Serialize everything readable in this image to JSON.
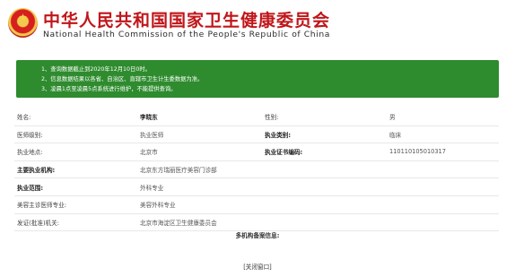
{
  "header": {
    "title_cn": "中华人民共和国国家卫生健康委员会",
    "title_en": "National Health Commission of the People's Republic of China",
    "emblem_icon": "national-emblem-icon"
  },
  "notice": {
    "lines": [
      "1、查询数据截止到2020年12月10日0时。",
      "2、信息数据结果以各省、自治区、直辖市卫生计生委数据为准。",
      "3、凌晨1点至凌晨5点系统进行维护，不能提供查询。"
    ],
    "background_color": "#2e8b2e"
  },
  "info": {
    "name_label": "姓名:",
    "name_value": "李晓东",
    "gender_label": "性别:",
    "gender_value": "男",
    "level_label": "医师级别:",
    "level_value": "执业医师",
    "category_label": "执业类别:",
    "category_value": "临床",
    "location_label": "执业地点:",
    "location_value": "北京市",
    "cert_label": "执业证书编码:",
    "cert_value": "110110105010317",
    "org_label": "主要执业机构:",
    "org_value": "北京东方瑞丽医疗美容门诊部",
    "scope_label": "执业范围:",
    "scope_value": "外科专业",
    "cosmetic_label": "美容主诊医师专业:",
    "cosmetic_value": "美容外科专业",
    "authority_label": "发证(批准)机关:",
    "authority_value": "北京市海淀区卫生健康委员会"
  },
  "multi_org": {
    "title": "多机构备案信息:"
  },
  "footer": {
    "close_label": "[关闭窗口]"
  }
}
